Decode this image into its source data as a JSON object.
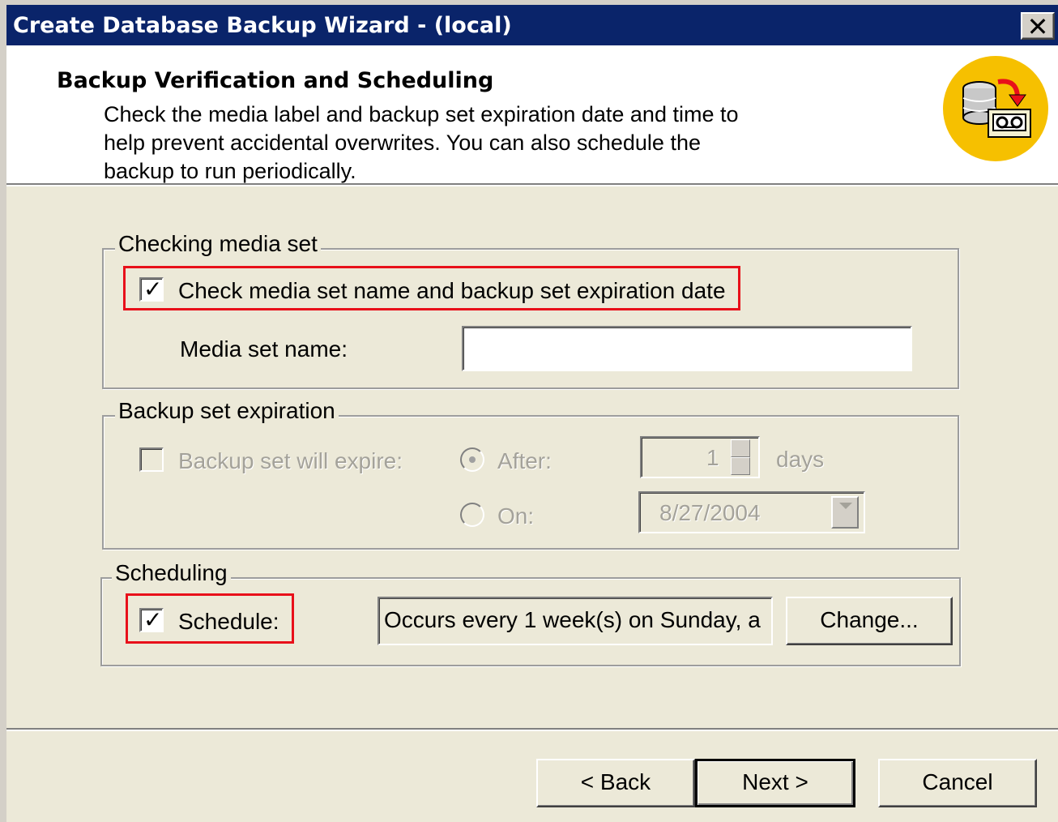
{
  "window": {
    "title": "Create Database Backup Wizard - (local)",
    "close_glyph": "✕"
  },
  "header": {
    "title": "Backup Verification and Scheduling",
    "description": "Check the media label and backup set expiration date and time to help prevent accidental overwrites. You can also schedule the backup to run periodically.",
    "icon": "database-backup-tape-icon",
    "icon_bg_color": "#f6c000"
  },
  "checking_media_set": {
    "group_label": "Checking media set",
    "check_label": "Check media set name and backup set expiration date",
    "checked": true,
    "media_set_name_label": "Media set name:",
    "media_set_name_value": ""
  },
  "backup_set_expiration": {
    "group_label": "Backup set expiration",
    "expire_label": "Backup set will expire:",
    "expire_checked": false,
    "after_label": "After:",
    "after_value": "1",
    "days_label": "days",
    "on_label": "On:",
    "on_value": "8/27/2004",
    "selected_option": "After"
  },
  "scheduling": {
    "group_label": "Scheduling",
    "schedule_label": "Schedule:",
    "checked": true,
    "schedule_text": "Occurs every 1 week(s) on Sunday, a",
    "change_label": "Change..."
  },
  "footer": {
    "back_label": "< Back",
    "next_label": "Next >",
    "cancel_label": "Cancel"
  },
  "colors": {
    "titlebar": "#0a246a",
    "highlight": "#e8101a"
  }
}
